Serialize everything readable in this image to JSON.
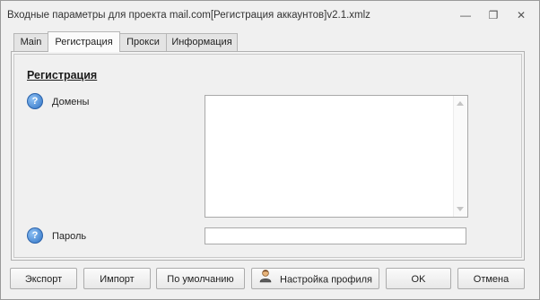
{
  "window": {
    "title": "Входные параметры для проекта mail.com[Регистрация аккаунтов]v2.1.xmlz",
    "controls": {
      "minimize": "—",
      "restore": "❐",
      "close": "✕"
    }
  },
  "tabs": [
    {
      "label": "Main",
      "active": false
    },
    {
      "label": "Регистрация",
      "active": true
    },
    {
      "label": "Прокси",
      "active": false
    },
    {
      "label": "Информация",
      "active": false
    }
  ],
  "panel": {
    "section_title": "Регистрация",
    "fields": {
      "domains": {
        "label": "Домены",
        "value": ""
      },
      "password": {
        "label": "Пароль",
        "value": ""
      }
    },
    "help_glyph": "?"
  },
  "buttons": {
    "export": "Экспорт",
    "import": "Импорт",
    "default": "По умолчанию",
    "profile": "Настройка профиля",
    "ok": "OK",
    "cancel": "Отмена"
  },
  "colors": {
    "help_icon": "#2f72c4",
    "window_bg": "#f0f0f0"
  }
}
